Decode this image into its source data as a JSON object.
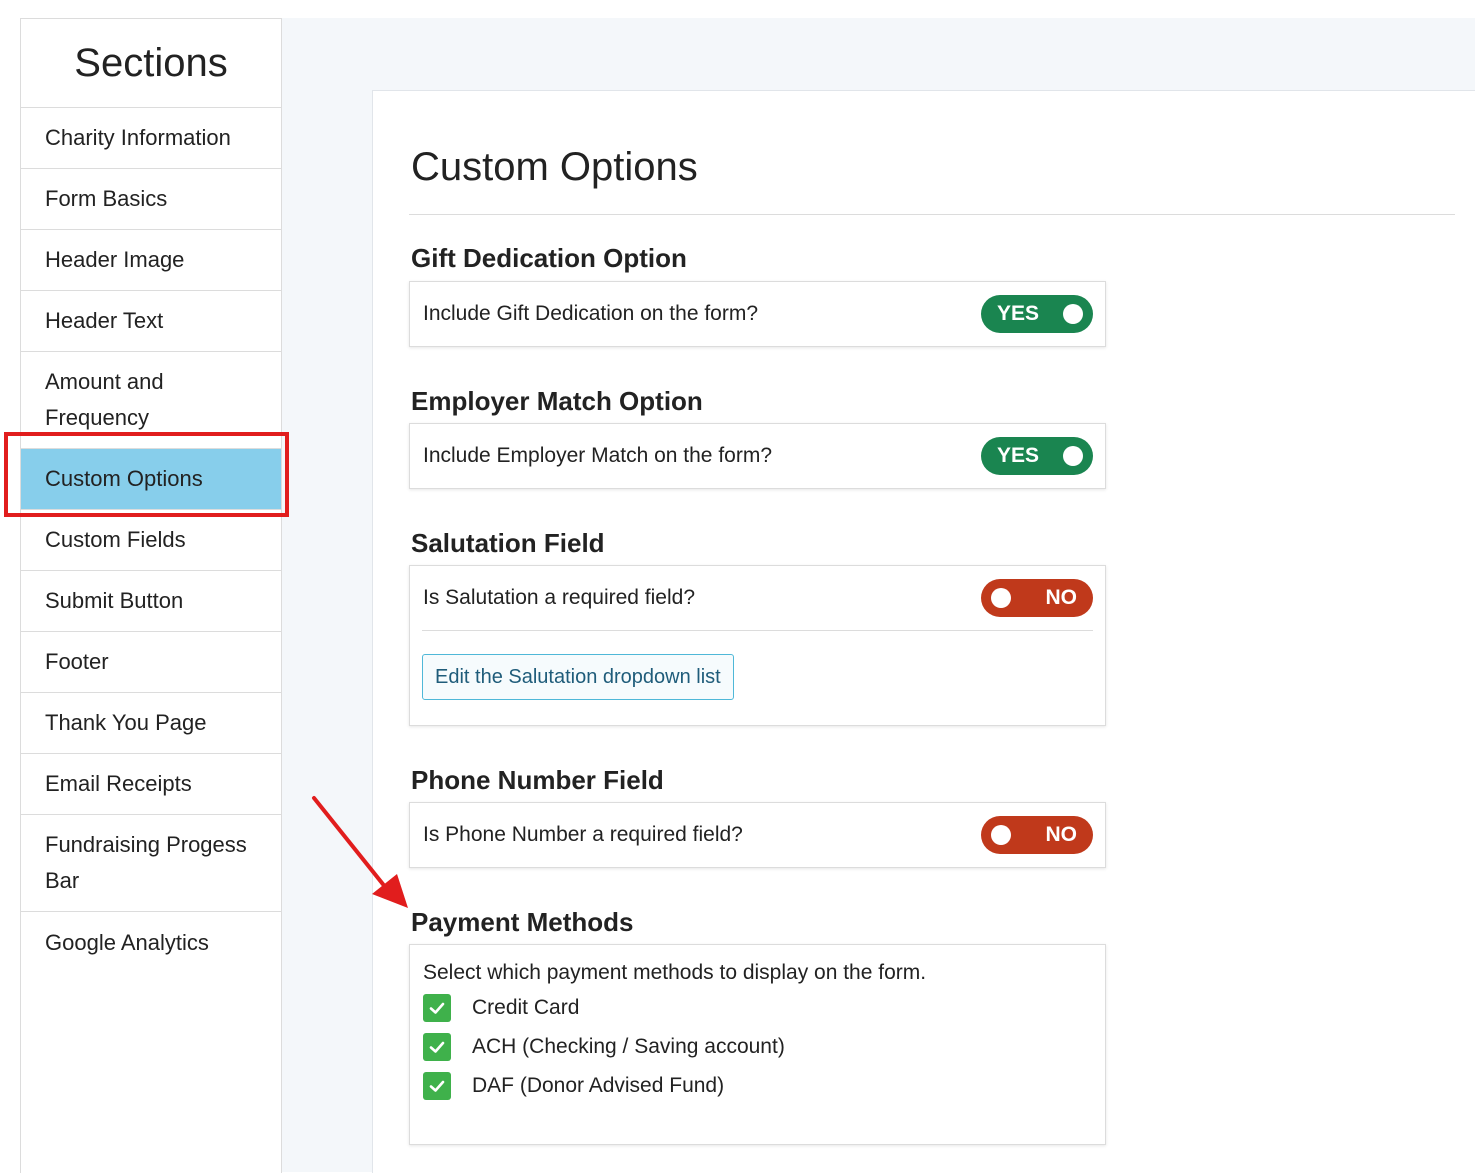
{
  "sidebar": {
    "title": "Sections",
    "items": [
      {
        "label": "Charity Information"
      },
      {
        "label": "Form Basics"
      },
      {
        "label": "Header Image"
      },
      {
        "label": "Header Text"
      },
      {
        "label": "Amount and Frequency"
      },
      {
        "label": "Custom Options",
        "active": true
      },
      {
        "label": "Custom Fields"
      },
      {
        "label": "Submit Button"
      },
      {
        "label": "Footer"
      },
      {
        "label": "Thank You Page"
      },
      {
        "label": "Email Receipts"
      },
      {
        "label": "Fundraising Progess Bar"
      },
      {
        "label": "Google Analytics"
      }
    ]
  },
  "main": {
    "title": "Custom Options",
    "gift_dedication": {
      "heading": "Gift Dedication Option",
      "question": "Include Gift Dedication on the form?",
      "toggle": "YES"
    },
    "employer_match": {
      "heading": "Employer Match Option",
      "question": "Include Employer Match on the form?",
      "toggle": "YES"
    },
    "salutation": {
      "heading": "Salutation Field",
      "question": "Is Salutation a required field?",
      "toggle": "NO",
      "edit_button": "Edit the Salutation dropdown list"
    },
    "phone": {
      "heading": "Phone Number Field",
      "question": "Is Phone Number a required field?",
      "toggle": "NO"
    },
    "payment": {
      "heading": "Payment Methods",
      "intro": "Select which payment methods to display on the form.",
      "options": [
        {
          "label": "Credit Card",
          "checked": true
        },
        {
          "label": "ACH (Checking / Saving account)",
          "checked": true
        },
        {
          "label": "DAF (Donor Advised Fund)",
          "checked": true
        }
      ]
    }
  },
  "colors": {
    "active_item": "#87ceeb",
    "toggle_yes": "#1a8550",
    "toggle_no": "#c0391b",
    "checkbox": "#3fb14b",
    "annotation": "#e11d1d"
  }
}
